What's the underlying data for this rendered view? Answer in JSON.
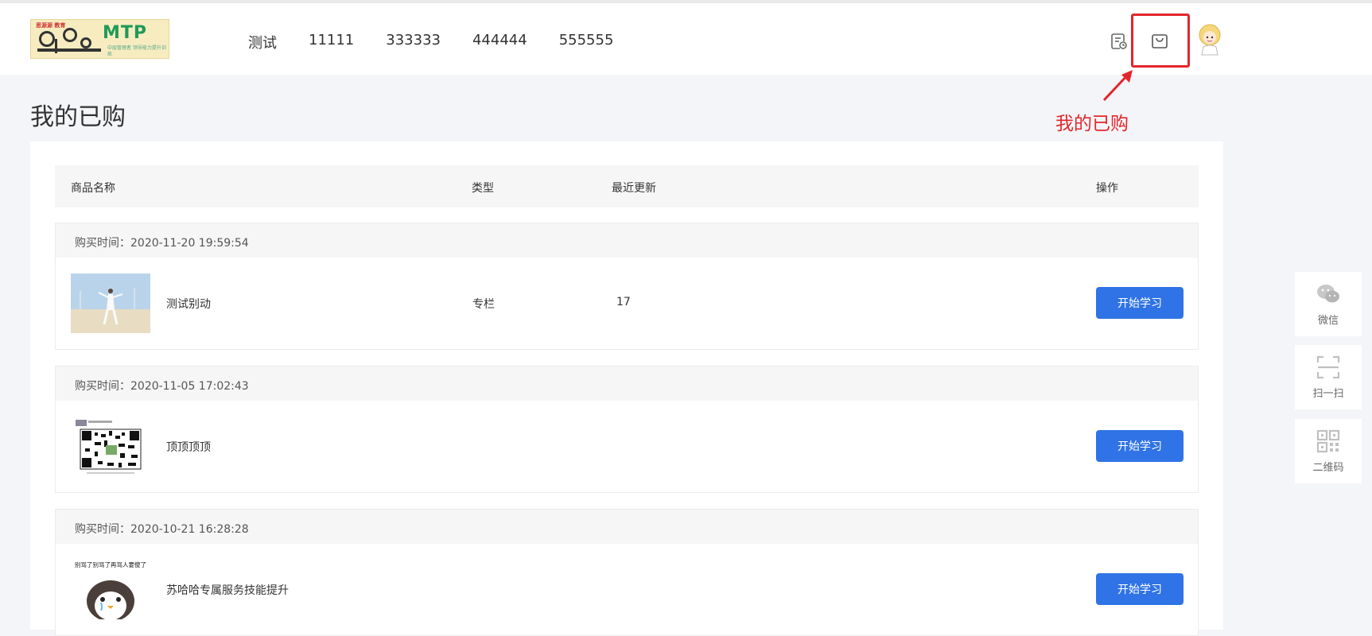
{
  "header": {
    "logo": {
      "badge": "思源源 教育",
      "brand": "MTP",
      "tagline": "中层管理者 领导能力提升训练"
    },
    "nav": [
      "测试",
      "11111",
      "333333",
      "444444",
      "555555"
    ],
    "icons": [
      "orders-icon",
      "shopping-bag-icon",
      "avatar"
    ],
    "annotation": "我的已购"
  },
  "page": {
    "title": "我的已购"
  },
  "table": {
    "columns": {
      "name": "商品名称",
      "type": "类型",
      "updated": "最近更新",
      "action": "操作"
    },
    "orders": [
      {
        "time": "购买时间：2020-11-20 19:59:54",
        "name": "测试别动",
        "type": "专栏",
        "updated": "17",
        "button": "开始学习",
        "thumb": "photo-person-beach"
      },
      {
        "time": "购买时间：2020-11-05 17:02:43",
        "name": "顶顶顶顶",
        "type": "",
        "updated": "",
        "button": "开始学习",
        "thumb": "qr-code-screenshot"
      },
      {
        "time": "购买时间：2020-10-21 16:28:28",
        "name": "苏哈哈专属服务技能提升",
        "type": "",
        "updated": "",
        "button": "开始学习",
        "thumb": "penguin-meme",
        "thumb_caption": "别骂了别骂了再骂人要傻了"
      }
    ]
  },
  "sidebar": [
    {
      "label": "微信",
      "icon": "wechat-icon"
    },
    {
      "label": "扫一扫",
      "icon": "scan-icon"
    },
    {
      "label": "二维码",
      "icon": "qrcode-icon"
    }
  ],
  "colors": {
    "accent": "#2f73e6",
    "annotation": "#e3262b",
    "background": "#f4f5f8"
  }
}
